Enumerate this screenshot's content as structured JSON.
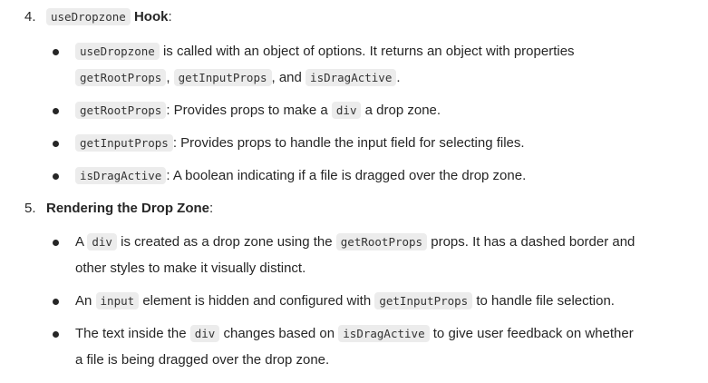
{
  "sections": [
    {
      "number": "4.",
      "heading_code": "useDropzone",
      "heading_text": "Hook",
      "heading_suffix": ":",
      "bullets": [
        {
          "l1_code": "useDropzone",
          "l1_text": "is called with an object of options. It returns an object with properties",
          "l2_code1": "getRootProps",
          "l2_text1": ",",
          "l2_code2": "getInputProps",
          "l2_text2": ", and",
          "l2_code3": "isDragActive",
          "l2_text3": "."
        },
        {
          "code": "getRootProps",
          "text1": ": Provides props to make a",
          "code2": "div",
          "text2": "a drop zone."
        },
        {
          "code": "getInputProps",
          "text1": ": Provides props to handle the input field for selecting files."
        },
        {
          "code": "isDragActive",
          "text1": ": A boolean indicating if a file is dragged over the drop zone."
        }
      ]
    },
    {
      "number": "5.",
      "heading_text": "Rendering the Drop Zone",
      "heading_suffix": ":",
      "bullets": [
        {
          "l1_text1": "A",
          "l1_code1": "div",
          "l1_text2": "is created as a drop zone using the",
          "l1_code2": "getRootProps",
          "l1_text3": "props. It has a dashed border and",
          "l2_text": "other styles to make it visually distinct."
        },
        {
          "text1": "An",
          "code1": "input",
          "text2": "element is hidden and configured with",
          "code2": "getInputProps",
          "text3": "to handle file selection."
        },
        {
          "l1_text1": "The text inside the",
          "l1_code1": "div",
          "l1_text2": "changes based on",
          "l1_code2": "isDragActive",
          "l1_text3": "to give user feedback on whether",
          "l2_text": "a file is being dragged over the drop zone."
        }
      ]
    }
  ]
}
